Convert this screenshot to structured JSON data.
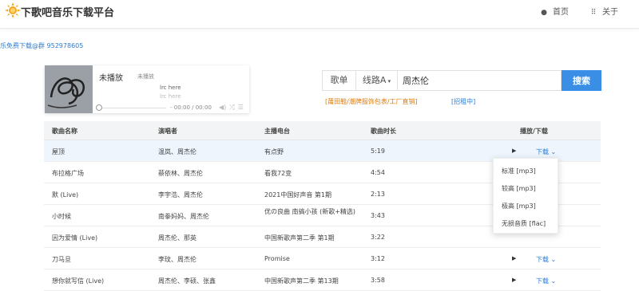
{
  "app": {
    "title": "下歌吧音乐下载平台",
    "nav_home": "首页",
    "nav_about": "关于"
  },
  "notice": "乐免费下载@群 952978605",
  "player": {
    "title": "未播放",
    "artist": "未播放",
    "lyric_line1": "lrc here",
    "lyric_line2": "lrc here",
    "time": "- 00:00 / 00:00"
  },
  "search": {
    "type": "歌单",
    "line": "线路A",
    "query": "周杰伦",
    "button": "搜索"
  },
  "ads": {
    "ad1": "[莆田鞋/潮牌服饰包表/工厂直销]",
    "ad2": "[招租中]"
  },
  "table": {
    "headers": [
      "歌曲名称",
      "演唱者",
      "主播电台",
      "歌曲时长",
      "播放/下载"
    ],
    "rows": [
      {
        "name": "屋顶",
        "singer": "温岚、周杰伦",
        "radio": "有点野",
        "duration": "5:19"
      },
      {
        "name": "布拉格广场",
        "singer": "蔡依林、周杰伦",
        "radio": "看我72变",
        "duration": "4:54"
      },
      {
        "name": "默 (Live)",
        "singer": "李宇浩、周杰伦",
        "radio": "2021中国好声音 第1期",
        "duration": "2:13"
      },
      {
        "name": "小时候",
        "singer": "南拳妈妈、周杰伦",
        "radio": "优の良曲 南搞小孩 (新歌+精选)",
        "duration": "3:43"
      },
      {
        "name": "因为爱情 (Live)",
        "singer": "周杰伦、那英",
        "radio": "中国新歌声第二季 第1期",
        "duration": "3:22"
      },
      {
        "name": "刀马旦",
        "singer": "李玟、周杰伦",
        "radio": "Promise",
        "duration": "3:12"
      },
      {
        "name": "想你就写信 (Live)",
        "singer": "周杰伦、李硕、张鑫",
        "radio": "中国新歌声第二季 第13期",
        "duration": "3:58"
      }
    ],
    "download_label": "下载"
  },
  "download_menu": [
    "标准 [mp3]",
    "较高 [mp3]",
    "极高 [mp3]",
    "无损音质 [flac]"
  ]
}
